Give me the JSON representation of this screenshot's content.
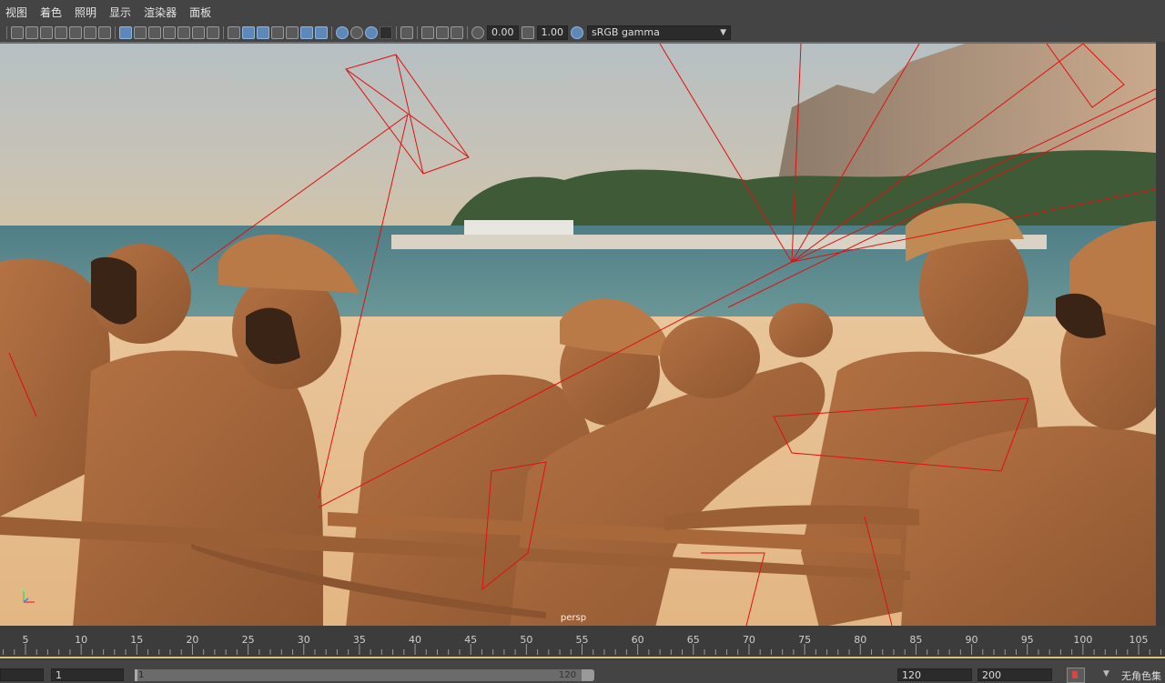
{
  "menubar": {
    "items": [
      "视图",
      "着色",
      "照明",
      "显示",
      "渲染器",
      "面板"
    ]
  },
  "toolbar": {
    "exposure_value": "0.00",
    "gamma_value": "1.00",
    "color_space": "sRGB gamma"
  },
  "viewport": {
    "camera_label": "persp"
  },
  "timeline": {
    "tick_labels": [
      "5",
      "10",
      "15",
      "20",
      "25",
      "30",
      "35",
      "40",
      "45",
      "50",
      "55",
      "60",
      "65",
      "70",
      "75",
      "80",
      "85",
      "90",
      "95",
      "100",
      "105"
    ]
  },
  "range": {
    "start_field": "",
    "inner_start": "1",
    "slider_start": "1",
    "slider_end": "120",
    "inner_end": "120",
    "end_field": "200",
    "character_set": "无角色集"
  },
  "colors": {
    "ui_bg": "#444444",
    "active_button": "#5d88b8",
    "wireframe": "#e01010",
    "figure_skin": "#a8683a"
  }
}
